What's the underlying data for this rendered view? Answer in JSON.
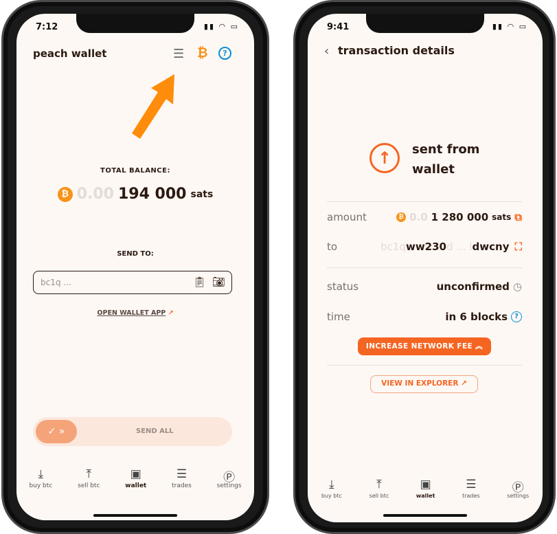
{
  "left": {
    "status_time": "7:12",
    "title": "peach wallet",
    "total_balance_label": "TOTAL BALANCE:",
    "balance_faded": "0.00",
    "balance_amount": "194 000",
    "balance_unit": "sats",
    "send_to_label": "SEND TO:",
    "address_placeholder": "bc1q ...",
    "open_wallet_app": "OPEN WALLET APP",
    "send_all": "SEND ALL",
    "nav": [
      {
        "label": "buy btc",
        "icon": "download-icon"
      },
      {
        "label": "sell btc",
        "icon": "upload-icon"
      },
      {
        "label": "wallet",
        "icon": "wallet-icon"
      },
      {
        "label": "trades",
        "icon": "list-icon"
      },
      {
        "label": "settings",
        "icon": "peach-icon"
      }
    ]
  },
  "right": {
    "status_time": "9:41",
    "title": "transaction details",
    "heading_line1": "sent from",
    "heading_line2": "wallet",
    "amount_label": "amount",
    "amount_faded": "0.0",
    "amount_value": "1 280 000",
    "amount_unit": "sats",
    "to_label": "to",
    "address_faded_start": "bc1q",
    "address_bold_start": "ww230",
    "address_faded_mid": "d ... l",
    "address_bold_end": "dwcny",
    "status_label": "status",
    "status_value": "unconfirmed",
    "time_label": "time",
    "time_value": "in 6 blocks",
    "increase_fee": "INCREASE NETWORK FEE",
    "view_explorer": "VIEW IN EXPLORER",
    "nav": [
      {
        "label": "buy btc",
        "icon": "download-icon"
      },
      {
        "label": "sell btc",
        "icon": "upload-icon"
      },
      {
        "label": "wallet",
        "icon": "wallet-icon"
      },
      {
        "label": "trades",
        "icon": "list-icon"
      },
      {
        "label": "settings",
        "icon": "peach-icon"
      }
    ]
  },
  "colors": {
    "accent": "#f56522",
    "bitcoin": "#f7931a",
    "help": "#0a8fd6",
    "background": "#fdf8f4"
  }
}
